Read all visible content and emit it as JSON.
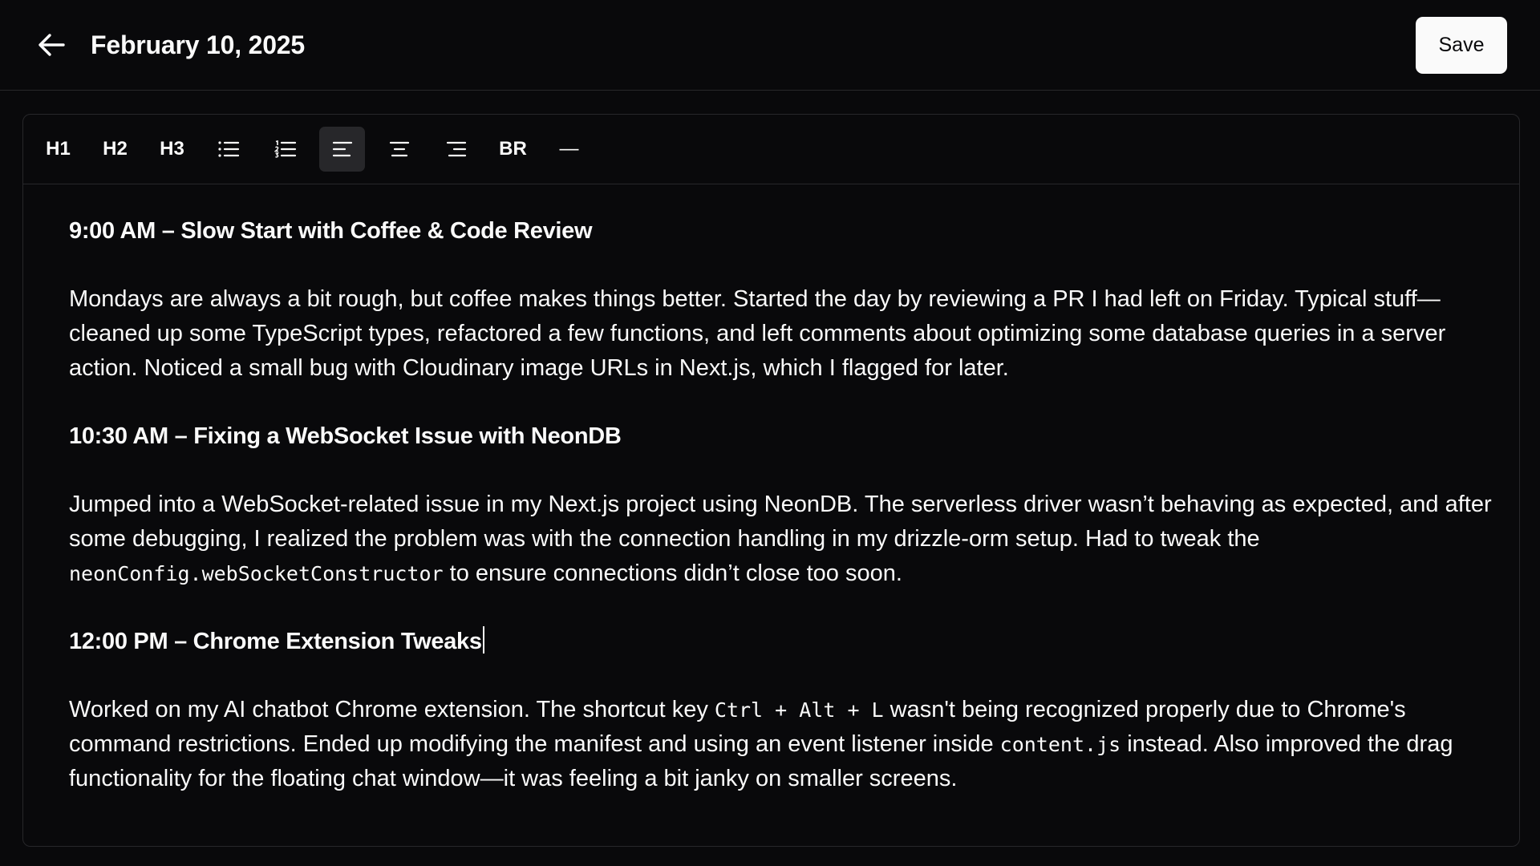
{
  "header": {
    "title": "February 10, 2025",
    "save_label": "Save"
  },
  "toolbar": {
    "h1": "H1",
    "h2": "H2",
    "h3": "H3",
    "br": "BR",
    "hr": "—",
    "active": "align-left"
  },
  "entries": [
    {
      "heading": "9:00 AM – Slow Start with Coffee & Code Review",
      "body": "Mondays are always a bit rough, but coffee makes things better. Started the day by reviewing a PR I had left on Friday. Typical stuff—cleaned up some TypeScript types, refactored a few functions, and left comments about optimizing some database queries in a server action. Noticed a small bug with Cloudinary image URLs in Next.js, which I flagged for later."
    },
    {
      "heading": "10:30 AM – Fixing a WebSocket Issue with NeonDB",
      "body_1": "Jumped into a WebSocket-related issue in my Next.js project using NeonDB. The serverless driver wasn’t behaving as expected, and after some debugging, I realized the problem was with the connection handling in my drizzle-orm setup. Had to tweak the",
      "code_1": "neonConfig.webSocketConstructor",
      "body_2": "to ensure connections didn’t close too soon."
    },
    {
      "heading": "12:00 PM – Chrome Extension Tweaks",
      "body_1": "Worked on my AI chatbot Chrome extension. The shortcut key",
      "code_1": "Ctrl + Alt + L",
      "body_2": "wasn't being recognized properly due to Chrome's command restrictions. Ended up modifying the manifest and using an event listener inside",
      "code_2": "content.js",
      "body_3": "instead. Also improved the drag functionality for the floating chat window—it was feeling a bit janky on smaller screens."
    }
  ]
}
